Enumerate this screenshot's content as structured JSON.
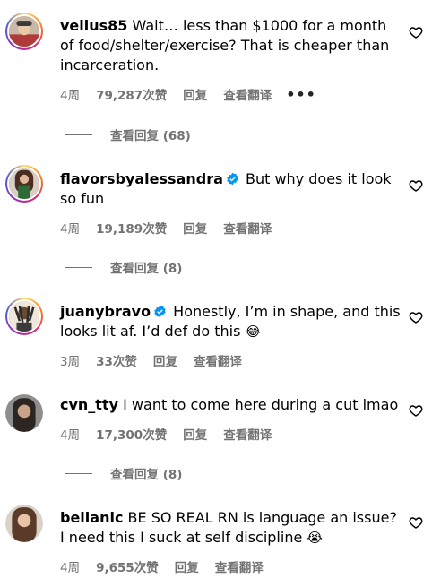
{
  "comments": [
    {
      "username": "velius85",
      "verified": false,
      "text": "Wait… less than $1000 for a month of food/shelter/exercise? That is cheaper than incarceration.",
      "emoji": "",
      "time": "4周",
      "likes": "79,287次赞",
      "reply": "回复",
      "translate": "查看翻译",
      "more": "•••",
      "replies": "查看回复 (68)"
    },
    {
      "username": "flavorsbyalessandra",
      "verified": true,
      "text": "But why does it look so fun",
      "emoji": "",
      "time": "4周",
      "likes": "19,189次赞",
      "reply": "回复",
      "translate": "查看翻译",
      "replies": "查看回复 (8)"
    },
    {
      "username": "juanybravo",
      "verified": true,
      "text": "Honestly, I’m in shape, and this looks lit af. I’d def do this",
      "emoji": "😂",
      "time": "3周",
      "likes": "33次赞",
      "reply": "回复",
      "translate": "查看翻译"
    },
    {
      "username": "cvn_tty",
      "verified": false,
      "text": "I want to come here during a cut lmao",
      "emoji": "",
      "time": "4周",
      "likes": "17,300次赞",
      "reply": "回复",
      "translate": "查看翻译",
      "replies": "查看回复 (8)"
    },
    {
      "username": "bellanic",
      "verified": false,
      "text": "BE SO REAL RN is language an issue? I need this I suck at self discipline",
      "emoji": "😭",
      "time": "4周",
      "likes": "9,655次赞",
      "reply": "回复",
      "translate": "查看翻译"
    }
  ],
  "colors": {
    "meta_gray": "#737373",
    "verified_blue": "#0095f6",
    "text": "#000000"
  }
}
